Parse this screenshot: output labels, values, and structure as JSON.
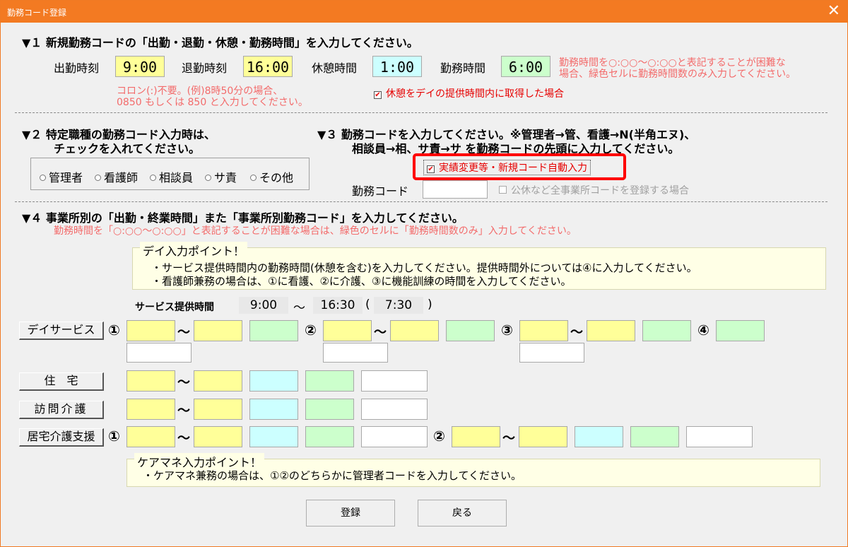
{
  "window": {
    "title": "勤務コード登録",
    "close_glyph": "✕"
  },
  "section1": {
    "heading": "▼１ 新規勤務コードの「出勤・退勤・休憩・勤務時間」を入力してください。",
    "start_label": "出勤時刻",
    "start_value": "9:00",
    "end_label": "退勤時刻",
    "end_value": "16:00",
    "break_label": "休憩時間",
    "break_value": "1:00",
    "work_label": "勤務時間",
    "work_value": "6:00",
    "note_right_1": "勤務時間を○:○○～○:○○と表記することが困難な",
    "note_right_2": "場合、緑色セルに勤務時間数のみ入力してください。",
    "note_left_1": "コロン(:)不要。(例)8時50分の場合、",
    "note_left_2": "0850 もしくは 850 と入力してください。",
    "break_checkbox_label": "休憩をデイの提供時間内に取得した場合",
    "check_glyph": "✔"
  },
  "section2": {
    "heading_1": "▼２ 特定職種の勤務コード入力時は、",
    "heading_2": "チェックを入れてください。",
    "options": [
      "管理者",
      "看護師",
      "相談員",
      "サ責",
      "その他"
    ]
  },
  "section3": {
    "heading_1": "▼３ 勤務コードを入力してください。※管理者→管、看護→N(半角エヌ)、",
    "heading_2": "相談員→相、サ責→サ を勤務コードの先頭に入力してください。",
    "auto_checkbox_label": "実績変更等・新規コード自動入力",
    "code_label": "勤務コード",
    "all_office_label": "公休など全事業所コードを登録する場合"
  },
  "section4": {
    "heading": "▼４ 事業所別の「出勤・終業時間」また「事業所別勤務コード」を入力してください。",
    "note": "勤務時間を「○:○○～○:○○」と表記することが困難な場合は、緑色のセルに「勤務時間数のみ」入力してください。",
    "day_info_legend": "デイ入力ポイント！",
    "day_info_line1": "・サービス提供時間内の勤務時間(休憩を含む)を入力してください。提供時間外については④に入力してください。",
    "day_info_line2": "・看護師兼務の場合は、①に看護、②に介護、③に機能訓練の時間を入力してください。",
    "service_label": "サービス提供時間",
    "service_start": "9:00",
    "service_tilde": "～",
    "service_end": "16:30",
    "service_paren_open": "(",
    "service_duration": "7:30",
    "service_paren_close": ")",
    "row_day": "デイサービス",
    "row_housing": "住　宅",
    "row_visit": "訪問介護",
    "row_home_support": "居宅介護支援",
    "circ1": "①",
    "circ2": "②",
    "circ3": "③",
    "circ4": "④",
    "tilde": "～",
    "care_info_legend": "ケアマネ入力ポイント！",
    "care_info_line1": "・ケアマネ兼務の場合は、①②のどちらかに管理者コードを入力してください。"
  },
  "buttons": {
    "register": "登録",
    "back": "戻る"
  },
  "colors": {
    "titlebar": "#f37a22",
    "highlight": "#ff0000",
    "yellow": "#ffff99",
    "cyan": "#ccffff",
    "green": "#ccffcc"
  }
}
